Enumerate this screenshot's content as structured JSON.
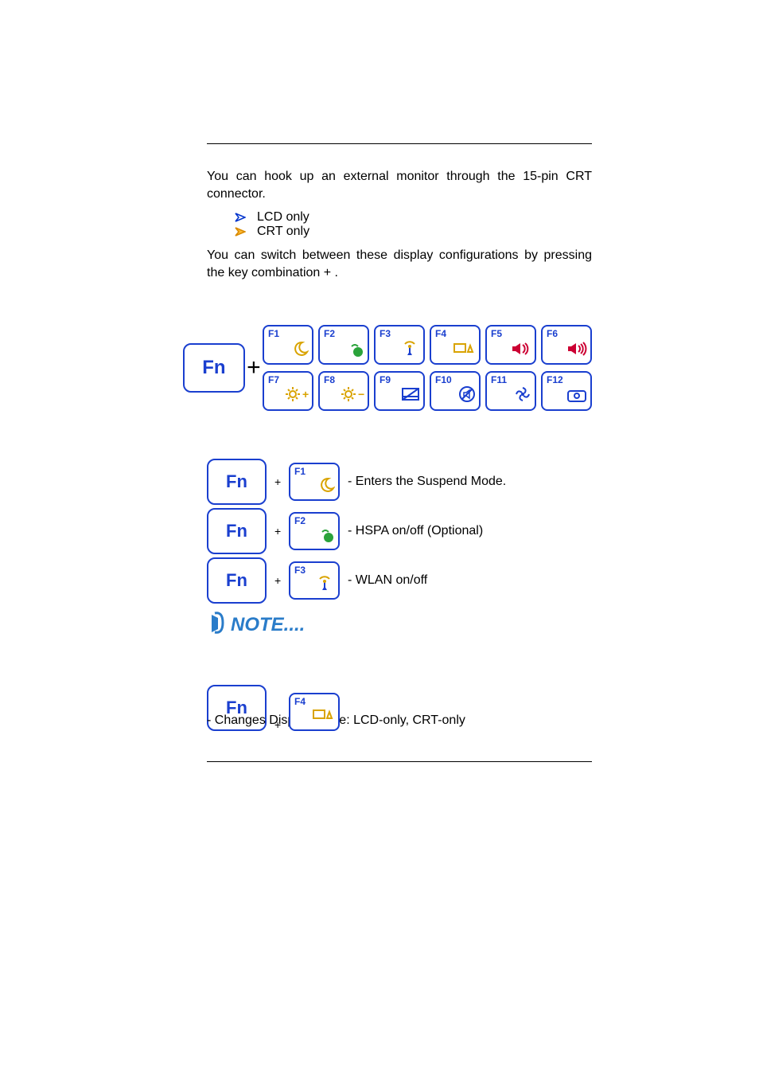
{
  "intro": "You can hook up an external monitor through the 15-pin CRT connector.",
  "bullets": [
    "LCD only",
    "CRT only"
  ],
  "switch_text": "You can switch between these display configurations by pressing the key combination        +       .",
  "fn_label": "Fn",
  "fkeys": {
    "row1": [
      "F1",
      "F2",
      "F3",
      "F4",
      "F5",
      "F6"
    ],
    "row2": [
      "F7",
      "F8",
      "F9",
      "F10",
      "F11",
      "F12"
    ]
  },
  "combos": [
    {
      "key": "F1",
      "desc": "- Enters the Suspend Mode."
    },
    {
      "key": "F2",
      "desc": "- HSPA on/off (Optional)"
    },
    {
      "key": "F3",
      "desc": "- WLAN on/off"
    }
  ],
  "note_label": "NOTE....",
  "combo4": {
    "key": "F4",
    "desc": "- Changes Display Mode: LCD-only, CRT-only"
  }
}
